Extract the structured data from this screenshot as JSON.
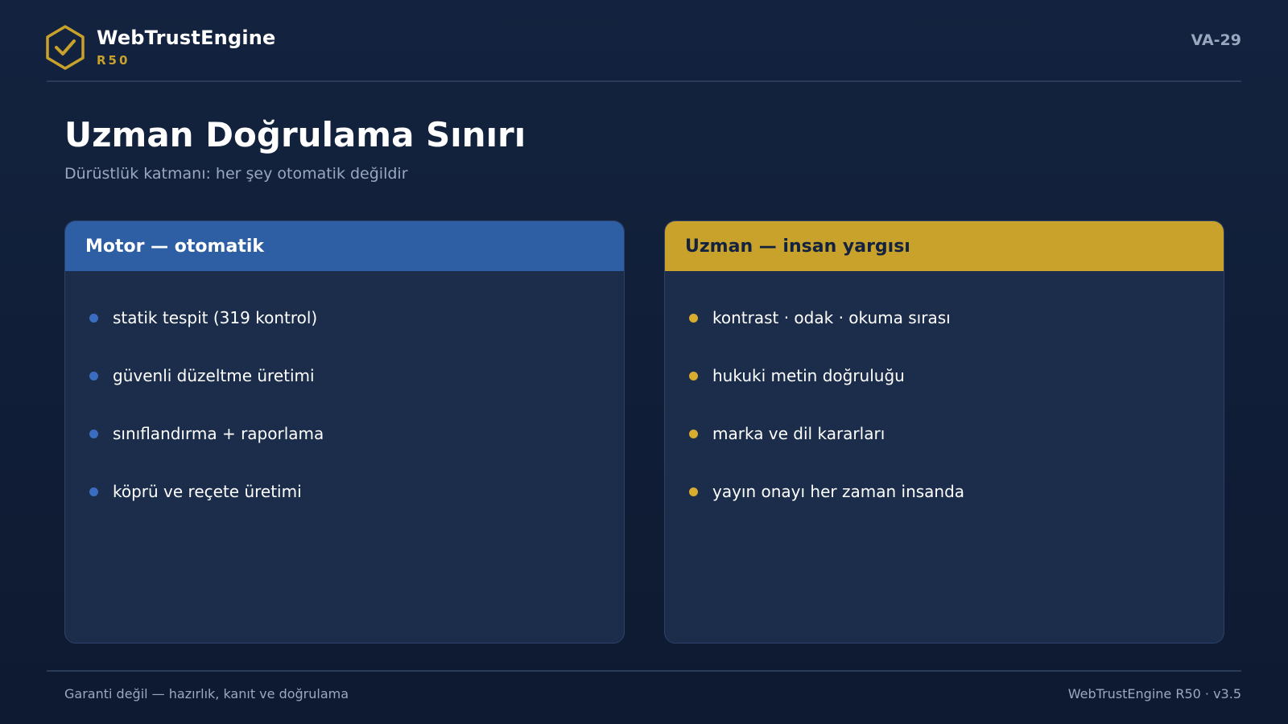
{
  "brand": {
    "name": "WebTrustEngine",
    "sub": "R50",
    "logo_icon": "shield-check-icon",
    "accent_color": "#c9a22b"
  },
  "slide_code": "VA-29",
  "title": "Uzman Doğrulama Sınırı",
  "subtitle": "Dürüstlük katmanı: her şey otomatik değildir",
  "cards": [
    {
      "header": "Motor — otomatik",
      "color": "#2e5fa5",
      "items": [
        "statik tespit (319 kontrol)",
        "güvenli düzeltme üretimi",
        "sınıflandırma + raporlama",
        "köprü ve reçete üretimi"
      ]
    },
    {
      "header": "Uzman — insan yargısı",
      "color": "#c9a22b",
      "items": [
        "kontrast · odak · okuma sırası",
        "hukuki metin doğruluğu",
        "marka ve dil kararları",
        "yayın onayı her zaman insanda"
      ]
    }
  ],
  "footer": {
    "left": "Garanti değil — hazırlık, kanıt ve doğrulama",
    "right": "WebTrustEngine R50 · v3.5"
  }
}
